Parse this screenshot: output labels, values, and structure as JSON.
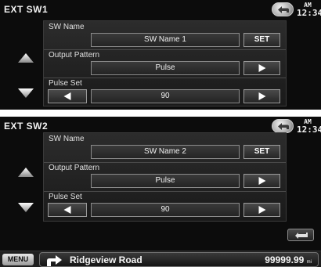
{
  "screens": [
    {
      "title": "EXT SW1",
      "clock": {
        "ampm": "AM",
        "time": "12:34"
      },
      "sw_name": {
        "label": "SW Name",
        "value": "SW   Name 1",
        "set_label": "SET"
      },
      "output_pattern": {
        "label": "Output Pattern",
        "value": "Pulse"
      },
      "pulse_set": {
        "label": "Pulse Set",
        "value": "90"
      }
    },
    {
      "title": "EXT SW2",
      "clock": {
        "ampm": "AM",
        "time": "12:34"
      },
      "sw_name": {
        "label": "SW Name",
        "value": "SW   Name 2",
        "set_label": "SET"
      },
      "output_pattern": {
        "label": "Output Pattern",
        "value": "Pulse"
      },
      "pulse_set": {
        "label": "Pulse Set",
        "value": "90"
      }
    }
  ],
  "bottom_bar": {
    "menu_label": "MENU",
    "street": "Ridgeview Road",
    "distance": "99999.99",
    "distance_unit": "mi"
  },
  "icons": {
    "back": "back-arrow-icon",
    "scroll_up": "triangle-up-icon",
    "scroll_down": "triangle-down-icon",
    "left": "triangle-left-icon",
    "right": "triangle-right-icon",
    "return": "return-arrow-icon",
    "nav_turn": "turn-right-arrow-icon"
  }
}
